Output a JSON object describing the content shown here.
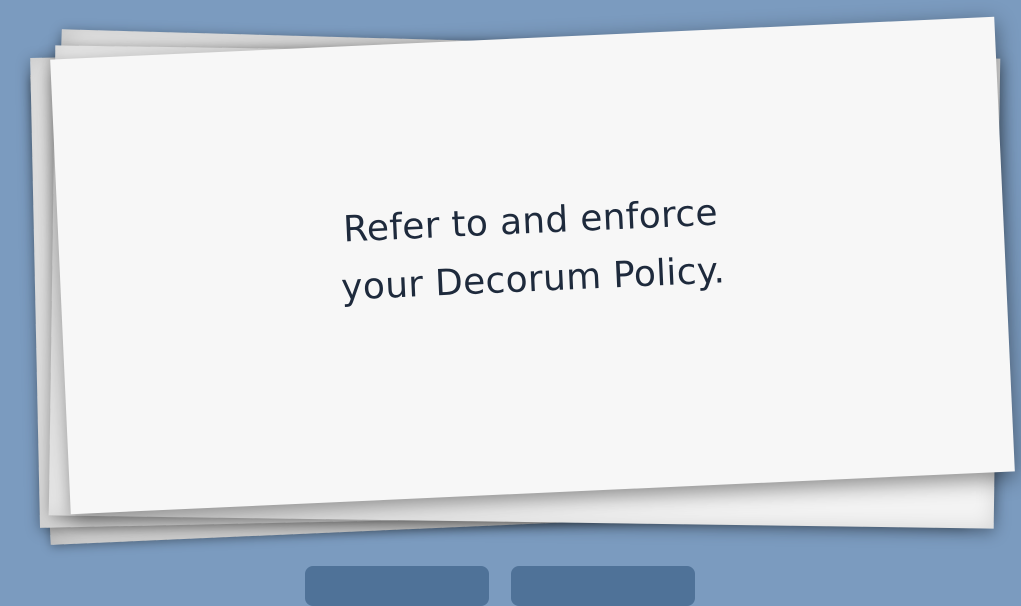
{
  "card": {
    "line1": "Refer to and enforce",
    "line2": "your Decorum Policy."
  },
  "colors": {
    "background": "#7b9bbf",
    "card": "#f7f7f7",
    "text": "#1e2a3c",
    "button": "#4f7298"
  }
}
